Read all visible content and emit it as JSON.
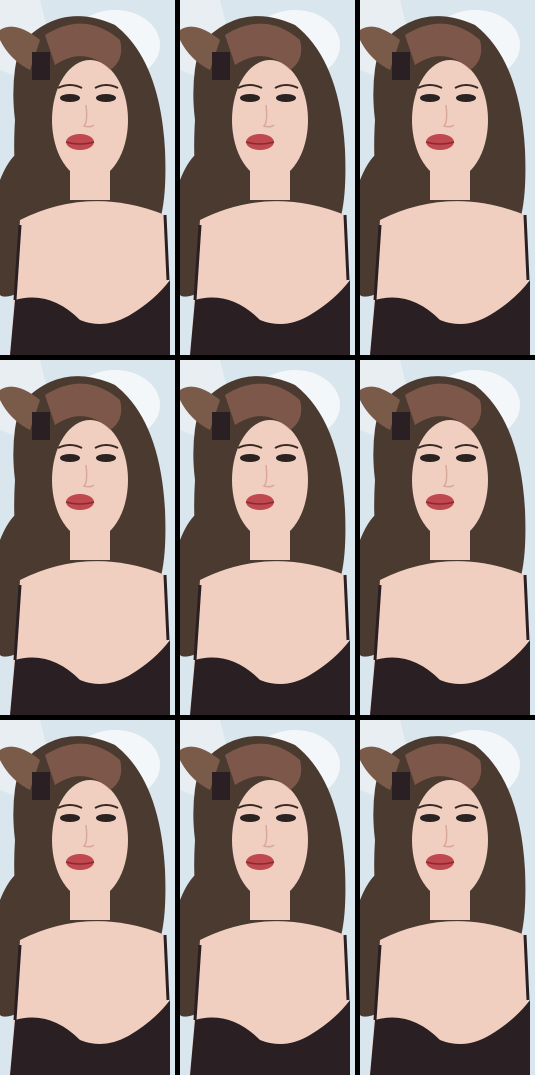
{
  "grid": {
    "rows": 3,
    "columns": 3,
    "frames": [
      {
        "row": 1,
        "column": 1
      },
      {
        "row": 1,
        "column": 2
      },
      {
        "row": 1,
        "column": 3
      },
      {
        "row": 2,
        "column": 1
      },
      {
        "row": 2,
        "column": 2
      },
      {
        "row": 2,
        "column": 3
      },
      {
        "row": 3,
        "column": 1
      },
      {
        "row": 3,
        "column": 2
      },
      {
        "row": 3,
        "column": 3
      }
    ]
  },
  "colors": {
    "background": "#d9e6ee",
    "separator": "#000000",
    "skin": "#f0cfc0",
    "hair": "#4a3a30",
    "top": "#2a1f22",
    "lips": "#c0484f"
  }
}
